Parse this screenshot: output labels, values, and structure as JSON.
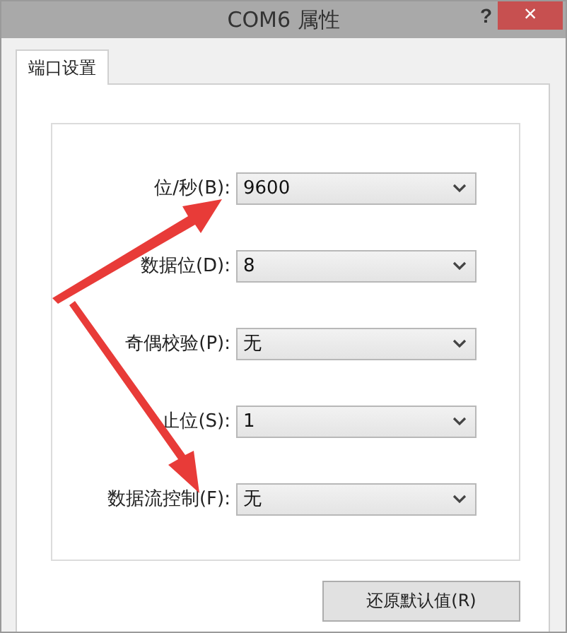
{
  "window": {
    "title": "COM6 属性",
    "help": "?",
    "close": "×"
  },
  "tabs": [
    {
      "label": "端口设置",
      "selected": true
    }
  ],
  "fields": [
    {
      "label": "位/秒(B):",
      "value": "9600"
    },
    {
      "label": "数据位(D):",
      "value": "8"
    },
    {
      "label": "奇偶校验(P):",
      "value": "无"
    },
    {
      "label": "止位(S):",
      "value": "1"
    },
    {
      "label": "数据流控制(F):",
      "value": "无"
    }
  ],
  "buttons": [
    "还原默认值(R)"
  ]
}
